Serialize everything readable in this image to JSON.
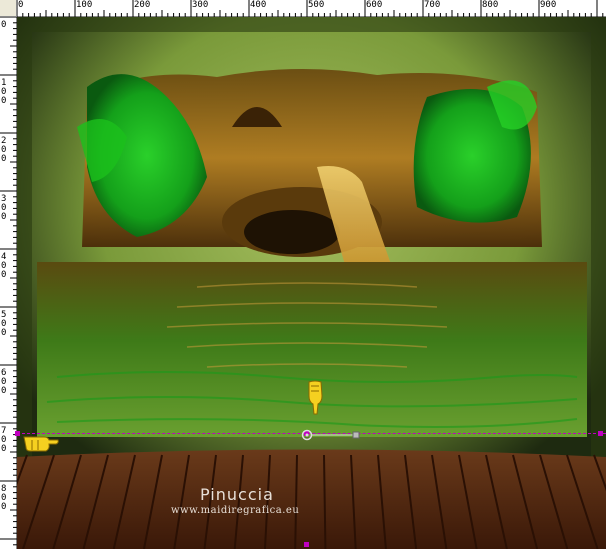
{
  "rulers": {
    "horizontal": [
      "0",
      "100",
      "200",
      "300",
      "400",
      "500",
      "600",
      "700",
      "800",
      "900"
    ],
    "vertical": [
      "0",
      "1 0 0",
      "2 0 0",
      "3 0 0",
      "4 0 0",
      "5 0 0",
      "6 0 0",
      "7 0 0",
      "8 0 0"
    ]
  },
  "watermark": {
    "name": "Pinuccia",
    "url": "www.maidiregrafica.eu"
  },
  "icons": {
    "pointer_down": "hand-pointer-down-icon",
    "pointer_right": "hand-pointer-right-icon",
    "move_handle": "rotation-handle-icon"
  },
  "colors": {
    "selection": "#c000c0",
    "foliage": "#22b022",
    "wood": "#5a2a14",
    "water": "#3a6a10"
  }
}
